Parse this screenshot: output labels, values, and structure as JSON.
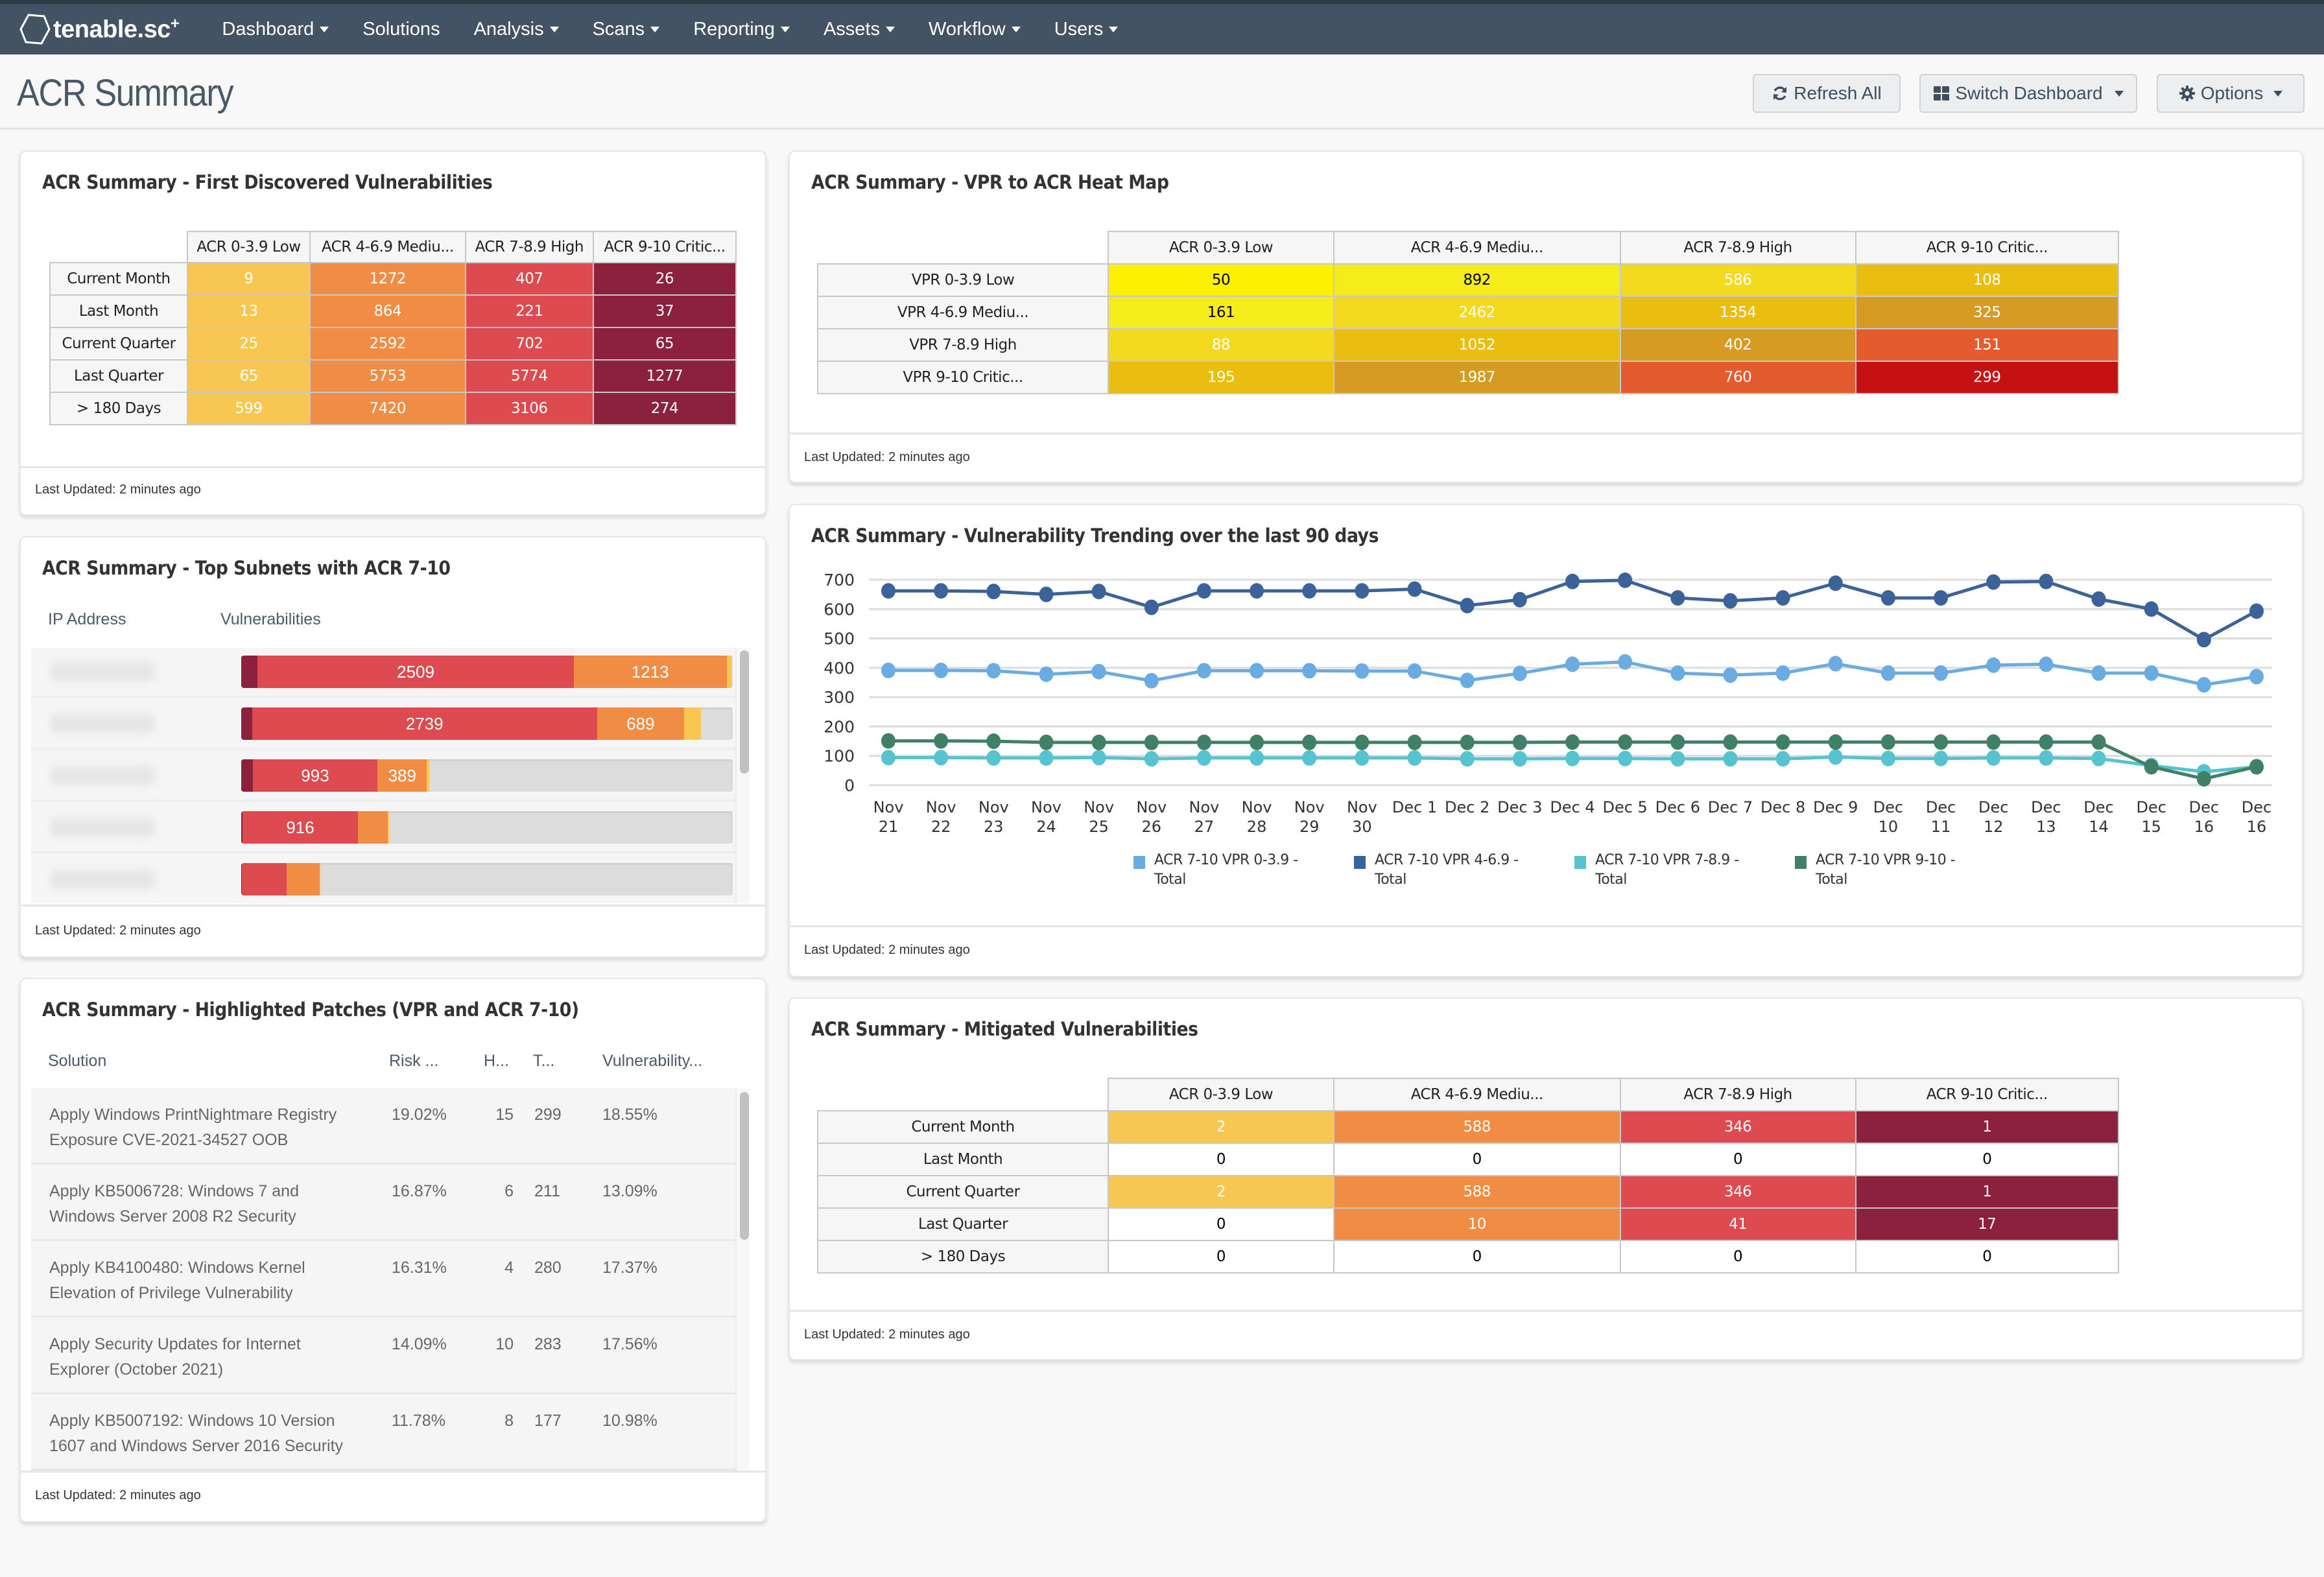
{
  "app": {
    "logo_text": "tenable.sc",
    "logo_sup": "+",
    "nav": [
      {
        "label": "Dashboard",
        "dropdown": true
      },
      {
        "label": "Solutions",
        "dropdown": false
      },
      {
        "label": "Analysis",
        "dropdown": true
      },
      {
        "label": "Scans",
        "dropdown": true
      },
      {
        "label": "Reporting",
        "dropdown": true
      },
      {
        "label": "Assets",
        "dropdown": true
      },
      {
        "label": "Workflow",
        "dropdown": true
      },
      {
        "label": "Users",
        "dropdown": true
      }
    ]
  },
  "header": {
    "title": "ACR Summary",
    "refresh_label": "Refresh All",
    "switch_label": "Switch Dashboard",
    "options_label": "Options"
  },
  "colors": {
    "navbar": "#435364",
    "acr_low": "#f7c752",
    "acr_medium": "#f08c43",
    "acr_high": "#dd4b50",
    "acr_critical": "#8c213e",
    "bar_empty": "#dcdcdc"
  },
  "first_discovered": {
    "title": "ACR Summary - First Discovered Vulnerabilities",
    "columns": [
      "ACR 0-3.9 Low",
      "ACR 4-6.9 Mediu...",
      "ACR 7-8.9 High",
      "ACR 9-10 Critic..."
    ],
    "rows": [
      {
        "label": "Current Month",
        "values": [
          "9",
          "1272",
          "407",
          "26"
        ]
      },
      {
        "label": "Last Month",
        "values": [
          "13",
          "864",
          "221",
          "37"
        ]
      },
      {
        "label": "Current Quarter",
        "values": [
          "25",
          "2592",
          "702",
          "65"
        ]
      },
      {
        "label": "Last Quarter",
        "values": [
          "65",
          "5753",
          "5774",
          "1277"
        ]
      },
      {
        "label": "> 180 Days",
        "values": [
          "599",
          "7420",
          "3106",
          "274"
        ]
      }
    ],
    "footer": "Last Updated: 2 minutes ago"
  },
  "heat_map": {
    "title": "ACR Summary - VPR to ACR Heat Map",
    "columns": [
      "ACR 0-3.9 Low",
      "ACR 4-6.9 Mediu...",
      "ACR 7-8.9 High",
      "ACR 9-10 Critic..."
    ],
    "rows": [
      {
        "label": "VPR 0-3.9 Low",
        "values": [
          "50",
          "892",
          "586",
          "108"
        ],
        "colors": [
          "#fdf100",
          "#f5ec1b",
          "#f4da1e",
          "#e9be0f"
        ],
        "text_colors": [
          "#000",
          "#000",
          "#fff",
          "#fff"
        ]
      },
      {
        "label": "VPR 4-6.9 Mediu...",
        "values": [
          "161",
          "2462",
          "1354",
          "325"
        ],
        "colors": [
          "#f5ec1b",
          "#f4da1e",
          "#e9be0f",
          "#d59b22"
        ],
        "text_colors": [
          "#000",
          "#fff",
          "#fff",
          "#fff"
        ]
      },
      {
        "label": "VPR 7-8.9 High",
        "values": [
          "88",
          "1052",
          "402",
          "151"
        ],
        "colors": [
          "#f4da1e",
          "#e9be0f",
          "#d59b22",
          "#e45c2e"
        ],
        "text_colors": [
          "#fff",
          "#fff",
          "#fff",
          "#fff"
        ]
      },
      {
        "label": "VPR 9-10 Critic...",
        "values": [
          "195",
          "1987",
          "760",
          "299"
        ],
        "colors": [
          "#e9be0f",
          "#d59b22",
          "#e45c2e",
          "#c51112"
        ],
        "text_colors": [
          "#fff",
          "#fff",
          "#fff",
          "#fff"
        ]
      }
    ],
    "footer": "Last Updated: 2 minutes ago"
  },
  "top_subnets": {
    "title": "ACR Summary - Top Subnets with ACR 7-10",
    "col_ip": "IP Address",
    "col_vulns": "Vulnerabilities",
    "max_total": 3900,
    "rows": [
      {
        "ip": "",
        "critical": 130,
        "high": 2509,
        "medium": 1213,
        "low": 40,
        "labels": {
          "high": "2509",
          "medium": "1213"
        }
      },
      {
        "ip": "",
        "critical": 85,
        "high": 2739,
        "medium": 689,
        "low": 135,
        "labels": {
          "high": "2739",
          "medium": "689"
        }
      },
      {
        "ip": "",
        "critical": 90,
        "high": 993,
        "medium": 389,
        "low": 20,
        "labels": {
          "high": "993",
          "medium": "389"
        }
      },
      {
        "ip": "",
        "critical": 10,
        "high": 916,
        "medium": 235,
        "low": 10,
        "labels": {
          "high": "916",
          "medium": ""
        }
      },
      {
        "ip": "",
        "critical": 5,
        "high": 355,
        "medium": 260,
        "low": 5,
        "labels": {
          "high": "",
          "medium": ""
        }
      }
    ],
    "footer": "Last Updated: 2 minutes ago"
  },
  "patches": {
    "title": "ACR Summary - Highlighted Patches (VPR and ACR 7-10)",
    "columns": [
      "Solution",
      "Risk ...",
      "H...",
      "T...",
      "Vulnerability..."
    ],
    "rows": [
      {
        "solution": "Apply Windows PrintNightmare Registry Exposure CVE-2021-34527 OOB",
        "risk": "19.02%",
        "hosts": "15",
        "total": "299",
        "vuln": "18.55%"
      },
      {
        "solution": "Apply KB5006728: Windows 7 and Windows Server 2008 R2 Security",
        "risk": "16.87%",
        "hosts": "6",
        "total": "211",
        "vuln": "13.09%"
      },
      {
        "solution": "Apply KB4100480: Windows Kernel Elevation of Privilege Vulnerability",
        "risk": "16.31%",
        "hosts": "4",
        "total": "280",
        "vuln": "17.37%"
      },
      {
        "solution": "Apply Security Updates for Internet Explorer (October 2021)",
        "risk": "14.09%",
        "hosts": "10",
        "total": "283",
        "vuln": "17.56%"
      },
      {
        "solution": "Apply KB5007192: Windows 10 Version 1607 and Windows Server 2016 Security",
        "risk": "11.78%",
        "hosts": "8",
        "total": "177",
        "vuln": "10.98%"
      }
    ],
    "footer": "Last Updated: 2 minutes ago"
  },
  "trend": {
    "title": "ACR Summary - Vulnerability Trending over the last 90 days",
    "footer": "Last Updated: 2 minutes ago"
  },
  "chart_data": {
    "type": "line",
    "title": "ACR Summary - Vulnerability Trending over the last 90 days",
    "xlabel": "",
    "ylabel": "",
    "ylim": [
      0,
      700
    ],
    "yticks": [
      0,
      100,
      200,
      300,
      400,
      500,
      600,
      700
    ],
    "grid": true,
    "legend_position": "bottom",
    "x": [
      "Nov 21",
      "Nov 22",
      "Nov 23",
      "Nov 24",
      "Nov 25",
      "Nov 26",
      "Nov 27",
      "Nov 28",
      "Nov 29",
      "Nov 30",
      "Dec 1",
      "Dec 2",
      "Dec 3",
      "Dec 4",
      "Dec 5",
      "Dec 6",
      "Dec 7",
      "Dec 8",
      "Dec 9",
      "Dec 10",
      "Dec 11",
      "Dec 12",
      "Dec 13",
      "Dec 14",
      "Dec 15",
      "Dec 16",
      "Dec 16"
    ],
    "x_lines": [
      [
        "Nov",
        "21"
      ],
      [
        "Nov",
        "22"
      ],
      [
        "Nov",
        "23"
      ],
      [
        "Nov",
        "24"
      ],
      [
        "Nov",
        "25"
      ],
      [
        "Nov",
        "26"
      ],
      [
        "Nov",
        "27"
      ],
      [
        "Nov",
        "28"
      ],
      [
        "Nov",
        "29"
      ],
      [
        "Nov",
        "30"
      ],
      [
        "Dec 1"
      ],
      [
        "Dec 2"
      ],
      [
        "Dec 3"
      ],
      [
        "Dec 4"
      ],
      [
        "Dec 5"
      ],
      [
        "Dec 6"
      ],
      [
        "Dec 7"
      ],
      [
        "Dec 8"
      ],
      [
        "Dec 9"
      ],
      [
        "Dec",
        "10"
      ],
      [
        "Dec",
        "11"
      ],
      [
        "Dec",
        "12"
      ],
      [
        "Dec",
        "13"
      ],
      [
        "Dec",
        "14"
      ],
      [
        "Dec",
        "15"
      ],
      [
        "Dec",
        "16"
      ],
      [
        "Dec",
        "16"
      ]
    ],
    "series": [
      {
        "name": "ACR 7-10 VPR 0-3.9 - Total",
        "color": "#6aace2",
        "values": [
          391,
          391,
          390,
          378,
          387,
          356,
          390,
          390,
          390,
          389,
          389,
          357,
          381,
          412,
          420,
          382,
          375,
          382,
          414,
          382,
          382,
          409,
          412,
          382,
          382,
          342,
          370
        ]
      },
      {
        "name": "ACR 7-10 VPR 4-6.9 - Total",
        "color": "#3b6399",
        "values": [
          662,
          662,
          660,
          650,
          660,
          606,
          662,
          662,
          662,
          662,
          668,
          612,
          632,
          694,
          698,
          638,
          628,
          638,
          688,
          638,
          638,
          692,
          694,
          634,
          600,
          496,
          593
        ]
      },
      {
        "name": "ACR 7-10 VPR 7-8.9 - Total",
        "color": "#57c2d0",
        "values": [
          94,
          94,
          93,
          93,
          94,
          90,
          93,
          93,
          93,
          93,
          93,
          90,
          90,
          91,
          91,
          90,
          90,
          90,
          96,
          91,
          91,
          93,
          93,
          91,
          67,
          46,
          63
        ]
      },
      {
        "name": "ACR 7-10 VPR 9-10 - Total",
        "color": "#3f8067",
        "values": [
          151,
          151,
          150,
          146,
          146,
          146,
          146,
          146,
          146,
          146,
          146,
          146,
          146,
          147,
          147,
          147,
          147,
          147,
          147,
          147,
          147,
          147,
          147,
          147,
          63,
          22,
          63
        ]
      }
    ]
  },
  "mitigated": {
    "title": "ACR Summary - Mitigated Vulnerabilities",
    "columns": [
      "ACR 0-3.9 Low",
      "ACR 4-6.9 Mediu...",
      "ACR 7-8.9 High",
      "ACR 9-10 Critic..."
    ],
    "rows": [
      {
        "label": "Current Month",
        "values": [
          "2",
          "588",
          "346",
          "1"
        ]
      },
      {
        "label": "Last Month",
        "values": [
          "0",
          "0",
          "0",
          "0"
        ]
      },
      {
        "label": "Current Quarter",
        "values": [
          "2",
          "588",
          "346",
          "1"
        ]
      },
      {
        "label": "Last Quarter",
        "values": [
          "0",
          "10",
          "41",
          "17"
        ]
      },
      {
        "label": "> 180 Days",
        "values": [
          "0",
          "0",
          "0",
          "0"
        ]
      }
    ],
    "footer": "Last Updated: 2 minutes ago"
  }
}
